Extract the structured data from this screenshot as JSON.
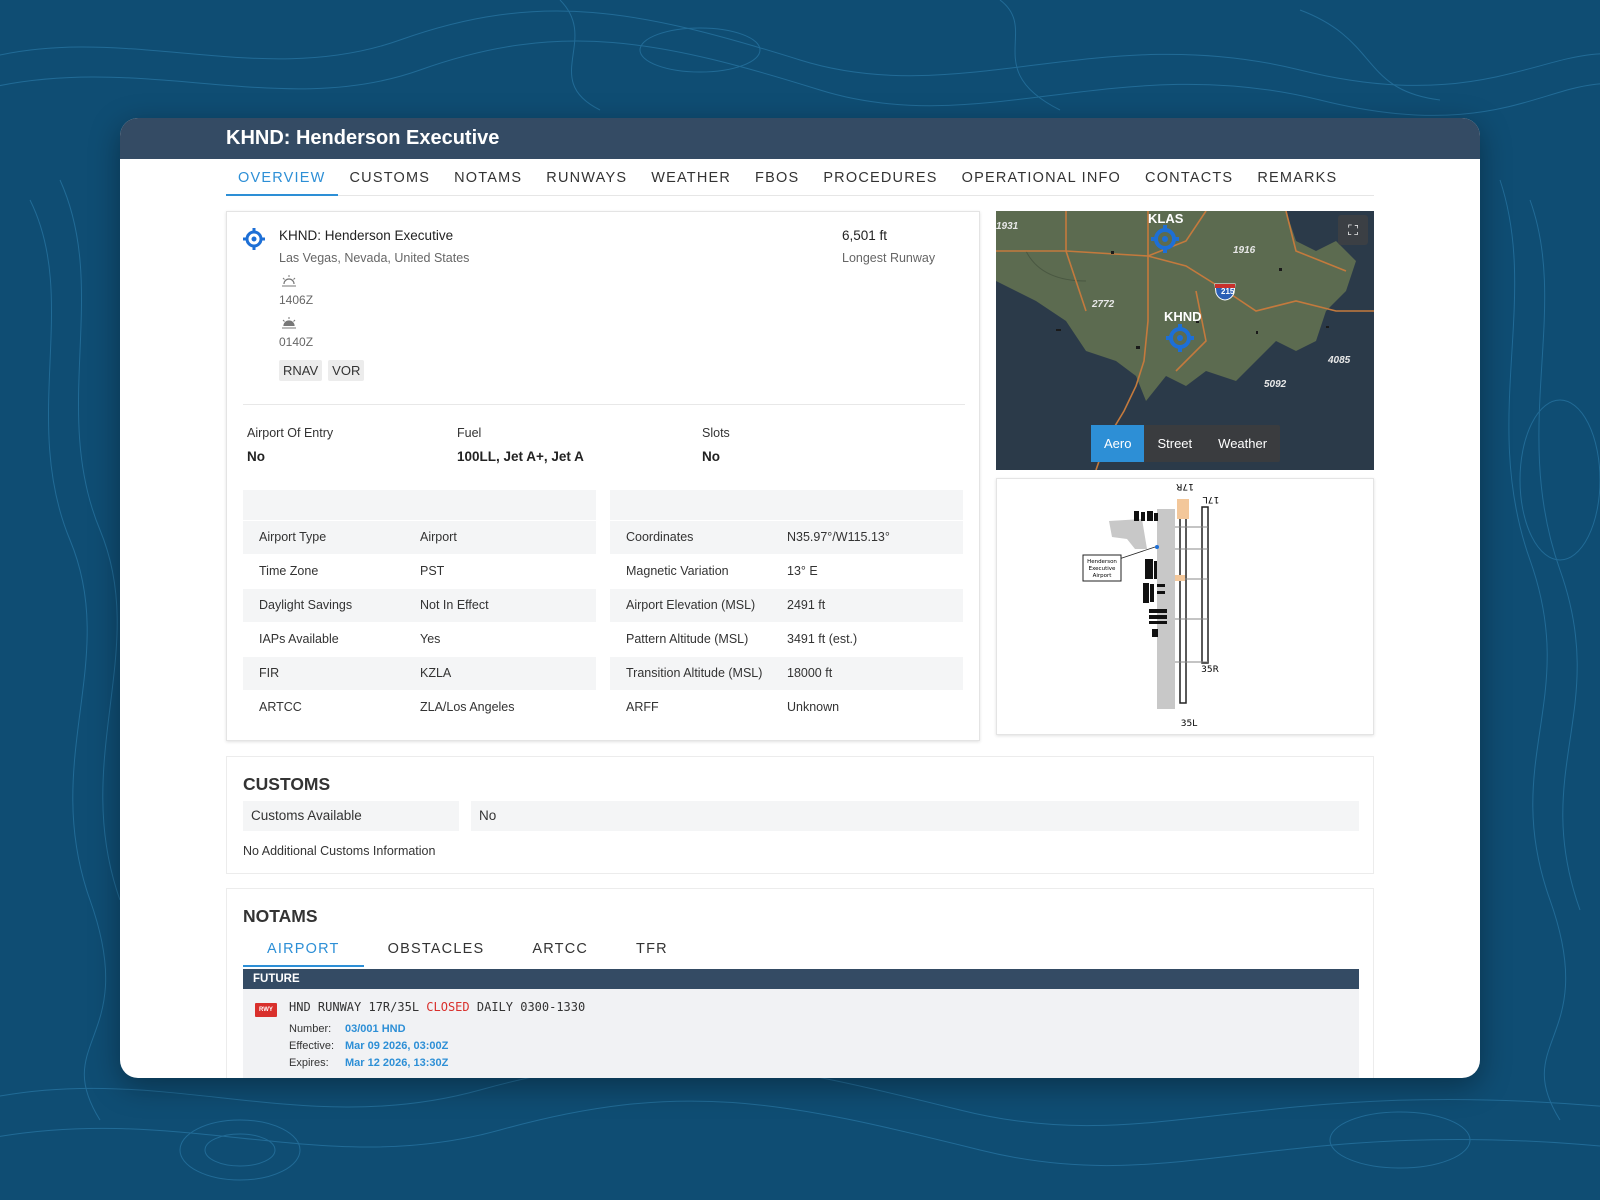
{
  "window": {
    "title": "KHND: Henderson Executive"
  },
  "tabs": [
    "OVERVIEW",
    "CUSTOMS",
    "NOTAMS",
    "RUNWAYS",
    "WEATHER",
    "FBOS",
    "PROCEDURES",
    "OPERATIONAL INFO",
    "CONTACTS",
    "REMARKS"
  ],
  "overview": {
    "airport_name": "KHND: Henderson Executive",
    "location": "Las Vegas, Nevada, United States",
    "sunrise": "1406Z",
    "sunset": "0140Z",
    "badges": [
      "RNAV",
      "VOR"
    ],
    "longest_runway_value": "6,501 ft",
    "longest_runway_label": "Longest Runway",
    "attributes": [
      {
        "label": "Airport Of Entry",
        "value": "No"
      },
      {
        "label": "Fuel",
        "value": "100LL, Jet A+, Jet A"
      },
      {
        "label": "Slots",
        "value": "No"
      }
    ],
    "left_table": [
      {
        "k": "Airport Type",
        "v": "Airport"
      },
      {
        "k": "Time Zone",
        "v": "PST"
      },
      {
        "k": "Daylight Savings",
        "v": "Not In Effect"
      },
      {
        "k": "IAPs Available",
        "v": "Yes"
      },
      {
        "k": "FIR",
        "v": "KZLA"
      },
      {
        "k": "ARTCC",
        "v": "ZLA/Los Angeles"
      }
    ],
    "right_table": [
      {
        "k": "Coordinates",
        "v": "N35.97°/W115.13°"
      },
      {
        "k": "Magnetic Variation",
        "v": "13° E"
      },
      {
        "k": "Airport Elevation (MSL)",
        "v": "2491 ft"
      },
      {
        "k": "Pattern Altitude (MSL)",
        "v": "3491 ft (est.)"
      },
      {
        "k": "Transition Altitude (MSL)",
        "v": "18000 ft"
      },
      {
        "k": "ARFF",
        "v": "Unknown"
      }
    ]
  },
  "map": {
    "codes": [
      "KLAS",
      "KHND"
    ],
    "elevations": [
      "1931",
      "1916",
      "2772",
      "4085",
      "5092"
    ],
    "shield": "215",
    "modes": [
      "Aero",
      "Street",
      "Weather"
    ],
    "active_mode": "Aero",
    "colors": {
      "terrain": "#5c6b50",
      "water": "#2b3a49",
      "roads": "#c47a3d",
      "pin": "#1d6fd6"
    }
  },
  "diagram": {
    "runway_labels": [
      "17R",
      "17L",
      "35R",
      "35L"
    ],
    "callout": [
      "Henderson",
      "Executive",
      "Airport"
    ]
  },
  "customs": {
    "title": "CUSTOMS",
    "row_key": "Customs Available",
    "row_value": "No",
    "note": "No Additional Customs Information"
  },
  "notams": {
    "title": "NOTAMS",
    "tabs": [
      "AIRPORT",
      "OBSTACLES",
      "ARTCC",
      "TFR"
    ],
    "group": "FUTURE",
    "item": {
      "icon": "RWY",
      "text_prefix": "HND RUNWAY 17R/35L ",
      "text_closed": "CLOSED",
      "text_suffix": " DAILY 0300-1330",
      "number_label": "Number:",
      "number": "03/001 HND",
      "effective_label": "Effective:",
      "effective": "Mar 09 2026, 03:00Z",
      "expires_label": "Expires:",
      "expires": "Mar 12 2026, 13:30Z"
    }
  }
}
